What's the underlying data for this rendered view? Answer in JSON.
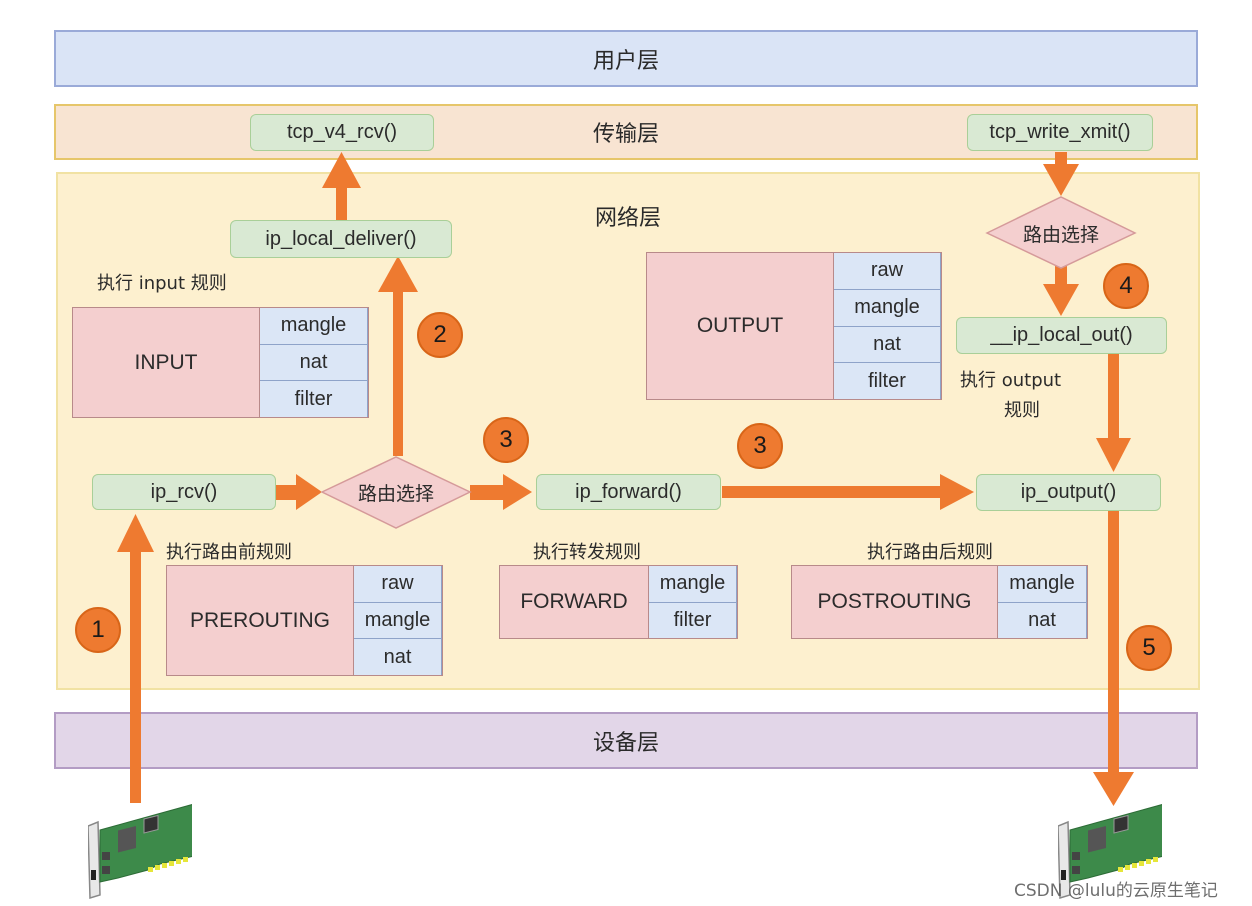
{
  "layers": {
    "user": "用户层",
    "transport": "传输层",
    "network": "网络层",
    "device": "设备层"
  },
  "functions": {
    "tcp_v4_rcv": "tcp_v4_rcv()",
    "tcp_write_xmit": "tcp_write_xmit()",
    "ip_local_deliver": "ip_local_deliver()",
    "ip_local_out": "__ip_local_out()",
    "ip_rcv": "ip_rcv()",
    "ip_forward": "ip_forward()",
    "ip_output": "ip_output()"
  },
  "decisions": {
    "routing_in": "路由选择",
    "routing_out": "路由选择"
  },
  "captions": {
    "input": "执行 input 规则",
    "output_line1": "执行 output",
    "output_line2": "规则",
    "prerouting": "执行路由前规则",
    "forward": "执行转发规则",
    "postrouting": "执行路由后规则"
  },
  "chains": {
    "input": {
      "name": "INPUT",
      "tables": [
        "mangle",
        "nat",
        "filter"
      ]
    },
    "output": {
      "name": "OUTPUT",
      "tables": [
        "raw",
        "mangle",
        "nat",
        "filter"
      ]
    },
    "prerouting": {
      "name": "PREROUTING",
      "tables": [
        "raw",
        "mangle",
        "nat"
      ]
    },
    "forward": {
      "name": "FORWARD",
      "tables": [
        "mangle",
        "filter"
      ]
    },
    "postrouting": {
      "name": "POSTROUTING",
      "tables": [
        "mangle",
        "nat"
      ]
    }
  },
  "steps": {
    "step1": "1",
    "step2": "2",
    "step3a": "3",
    "step3b": "3",
    "step4": "4",
    "step5": "5"
  },
  "icons": {
    "nic_in": "network-card-icon",
    "nic_out": "network-card-icon"
  },
  "colors": {
    "arrow": "#ee7a30",
    "user_layer": "#dae4f6",
    "transport_layer": "#f8e4d2",
    "network_layer": "#fdf0cf",
    "device_layer": "#e2d6e8",
    "function_box": "#d9e9d3",
    "chain_box": "#f4cfcf",
    "table_cell": "#dbe6f6"
  },
  "watermark": "CSDN @lulu的云原生笔记"
}
